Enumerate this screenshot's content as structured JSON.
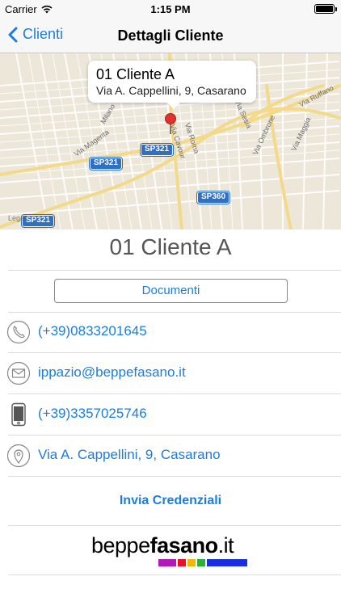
{
  "status_bar": {
    "carrier": "Carrier",
    "time": "1:15 PM",
    "battery_level": 1.0
  },
  "nav": {
    "back_label": "Clienti",
    "title": "Dettagli Cliente"
  },
  "map": {
    "callout_title": "01 Cliente A",
    "callout_subtitle": "Via A. Cappellini, 9, Casarano",
    "road_badges": [
      "SP321",
      "SP321",
      "SP360",
      "SP321"
    ],
    "streets": [
      "Via Ruffano",
      "Via Magenta",
      "Milano",
      "Via Roma",
      "Via Cavour",
      "Via Sesia",
      "Via Ombrone",
      "Via Maggia"
    ],
    "legal": "Legal"
  },
  "client": {
    "name": "01 Cliente A",
    "documents_label": "Documenti",
    "phone": "(+39)0833201645",
    "email": "ippazio@beppefasano.it",
    "mobile": "(+39)3357025746",
    "address": "Via A. Cappellini, 9, Casarano",
    "credentials_label": "Invia Credenziali"
  },
  "logo": {
    "text_regular": "beppe",
    "text_bold": "fasano",
    "text_suffix": ".it",
    "bar_colors": [
      "#b01ab8",
      "#e8132b",
      "#f2b705",
      "#2fae3a",
      "#1a2fe0"
    ]
  },
  "colors": {
    "accent": "#1a7ee0",
    "pin": "#e0332f",
    "road_badge": "#2f6fc4"
  }
}
